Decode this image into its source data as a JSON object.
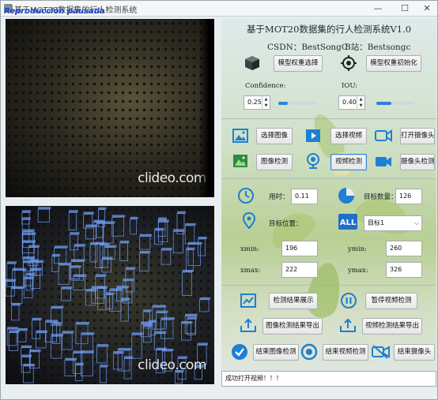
{
  "window": {
    "title": "基于MOT20数据集的行人检测系统",
    "overlay_text": "Reproducción pausada"
  },
  "videos": {
    "watermark_top": "clideo.com",
    "watermark_bottom": "clideo.com"
  },
  "header": {
    "title": "基于MOT20数据集的行人检测系统V1.0",
    "csdn": "CSDN：BestSongC",
    "bilibili": "B站：Bestsongc"
  },
  "model": {
    "select_label": "模型权重选择",
    "init_label": "模型权重初始化",
    "confidence_label": "Confidence:",
    "confidence_value": "0.25",
    "confidence_level": 0.25,
    "iou_label": "IOU:",
    "iou_value": "0.40",
    "iou_level": 0.4
  },
  "actions": {
    "select_image": "选择图像",
    "select_video": "选择视频",
    "open_camera": "打开摄像头",
    "image_detect": "图像检测",
    "video_detect": "视频检测",
    "camera_detect": "摄像头检测"
  },
  "results": {
    "time_label": "用时：",
    "time_value": "0.11",
    "count_label": "目标数量：",
    "count_value": "126",
    "position_label": "目标位置：",
    "target_select": "目标1",
    "xmin_label": "xmin:",
    "xmin_value": "196",
    "ymin_label": "ymin:",
    "ymin_value": "260",
    "xmax_label": "xmax:",
    "xmax_value": "222",
    "ymax_label": "ymax:",
    "ymax_value": "326"
  },
  "controls": {
    "show_results": "检测结果展示",
    "pause_video": "暂停视频检测",
    "export_image": "图像检测结果导出",
    "export_video": "视频检测结果导出",
    "end_image": "结束图像检测",
    "end_video": "结束视频检测",
    "end_camera": "结束摄像头"
  },
  "status": {
    "message": "成功打开视频！！！"
  },
  "colors": {
    "accent": "#2c83d8",
    "bbox": "#6f9cf0"
  }
}
